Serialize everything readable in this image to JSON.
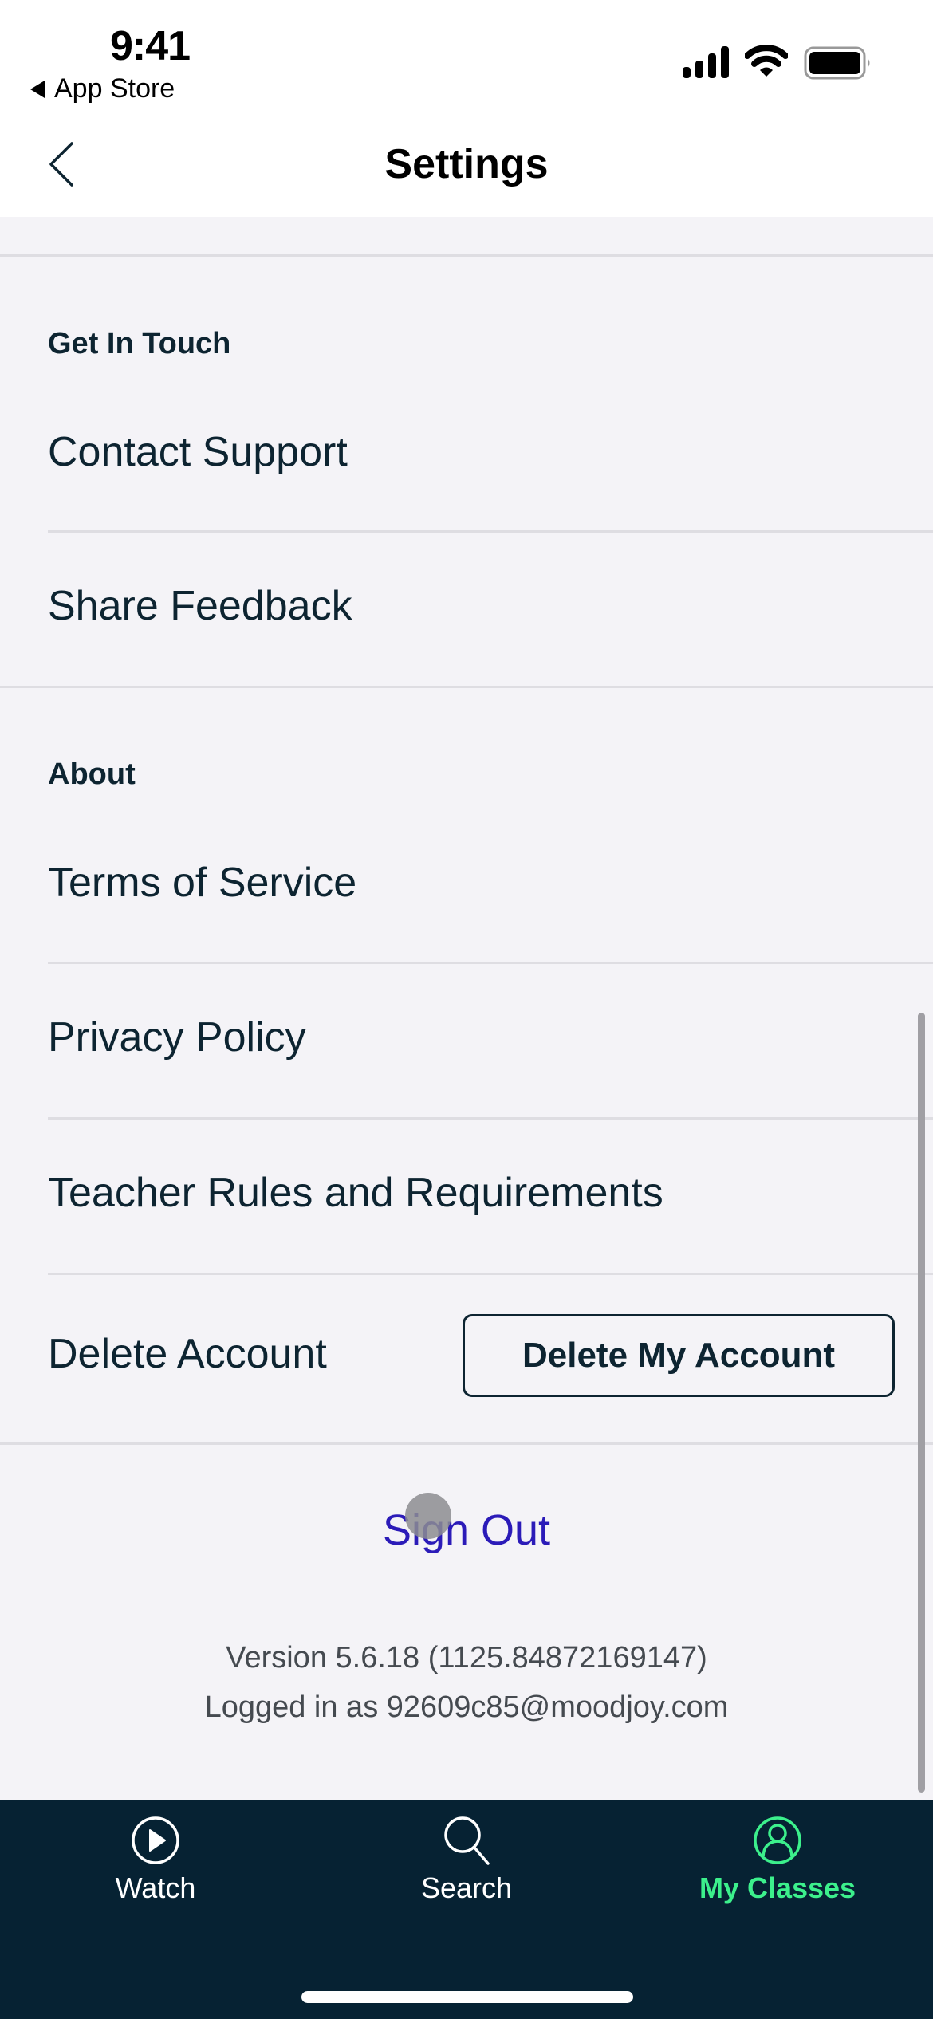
{
  "status_bar": {
    "time": "9:41",
    "back_app": "App Store",
    "icons": [
      "signal-icon",
      "wifi-icon",
      "battery-icon"
    ]
  },
  "header": {
    "title": "Settings",
    "back_icon": "chevron-left-icon"
  },
  "sections": [
    {
      "heading": "Get In Touch",
      "items": [
        {
          "label": "Contact Support"
        },
        {
          "label": "Share Feedback"
        }
      ]
    },
    {
      "heading": "About",
      "items": [
        {
          "label": "Terms of Service"
        },
        {
          "label": "Privacy Policy"
        },
        {
          "label": "Teacher Rules and Requirements"
        },
        {
          "label": "Delete Account",
          "button_label": "Delete My Account"
        }
      ]
    }
  ],
  "sign_out": "Sign Out",
  "version_text": "Version 5.6.18 (1125.84872169147)",
  "logged_in_text": "Logged in as 92609c85@moodjoy.com",
  "tab_bar": {
    "tabs": [
      {
        "label": "Watch",
        "icon": "play-circle-icon",
        "active": false
      },
      {
        "label": "Search",
        "icon": "search-icon",
        "active": false
      },
      {
        "label": "My Classes",
        "icon": "user-circle-icon",
        "active": true
      }
    ]
  },
  "colors": {
    "accent_active_tab": "#3cf08c",
    "sign_out": "#2b1bb8",
    "tab_bar_bg": "#062233",
    "text_primary": "#0d2431",
    "page_bg": "#f4f3f7"
  }
}
